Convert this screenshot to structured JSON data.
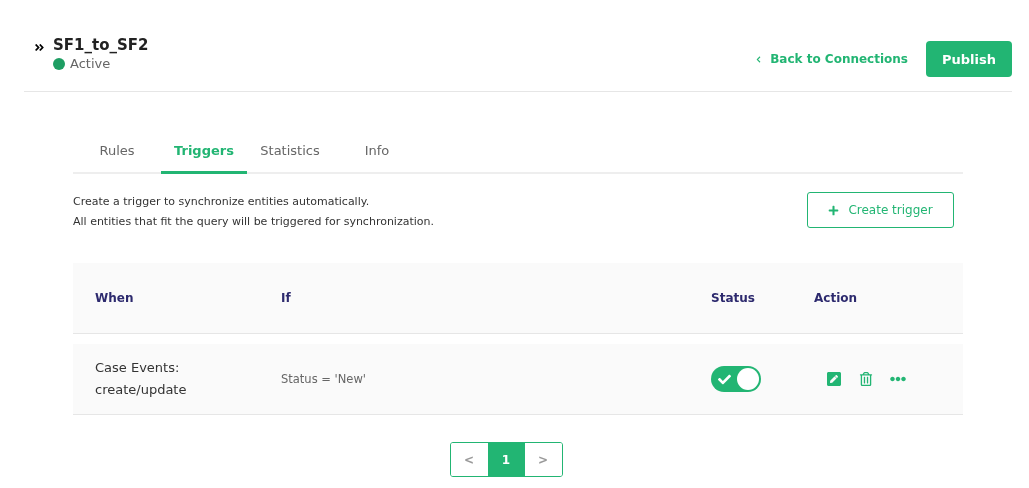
{
  "header": {
    "title": "SF1_to_SF2",
    "status": {
      "label": "Active",
      "color": "#1e9e63"
    },
    "back_link": "Back to Connections",
    "publish_button": "Publish"
  },
  "tabs": [
    {
      "label": "Rules",
      "selected": false
    },
    {
      "label": "Triggers",
      "selected": true
    },
    {
      "label": "Statistics",
      "selected": false
    },
    {
      "label": "Info",
      "selected": false
    }
  ],
  "description": [
    "Create a trigger to synchronize entities automatically.",
    "All entities that fit the query will be triggered for synchronization."
  ],
  "create_button": "Create trigger",
  "table": {
    "columns": [
      "When",
      "If",
      "Status",
      "Action"
    ],
    "rows": [
      {
        "when": [
          "Case Events:",
          "create/update"
        ],
        "if": "Status = 'New'",
        "on": true
      }
    ]
  },
  "pagination": {
    "prev": "<",
    "next": ">",
    "pages": [
      {
        "label": "1",
        "selected": true
      }
    ]
  }
}
